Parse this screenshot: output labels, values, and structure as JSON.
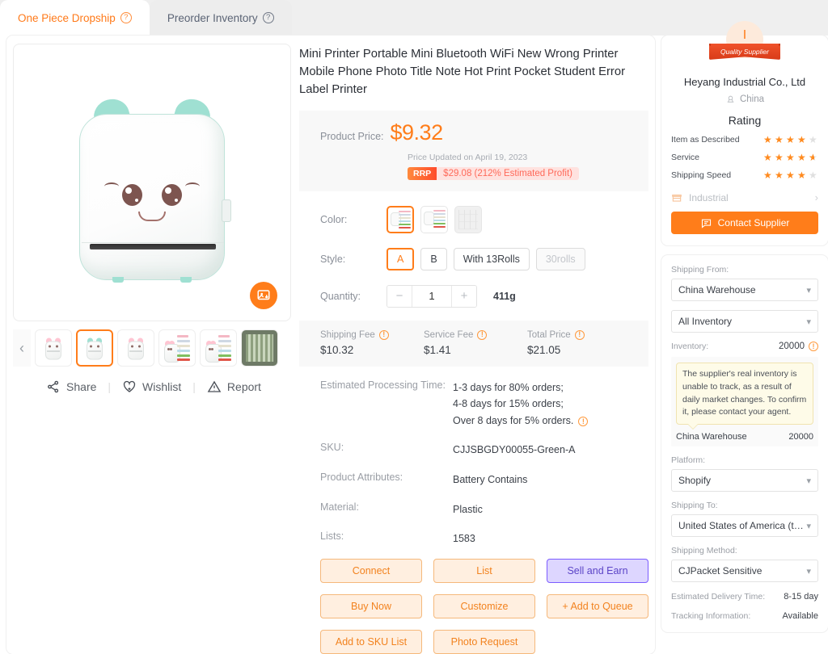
{
  "tabs": [
    {
      "label": "One Piece Dropship",
      "active": true
    },
    {
      "label": "Preorder Inventory",
      "active": false
    }
  ],
  "gallery": {
    "prev_icon": "chevron-left-icon",
    "download_icon": "image-download-icon",
    "selected_thumb_index": 1,
    "links": [
      {
        "label": "Share",
        "icon": "share-icon"
      },
      {
        "label": "Wishlist",
        "icon": "heart-plus-icon"
      },
      {
        "label": "Report",
        "icon": "warning-triangle-icon"
      }
    ],
    "separator": "|"
  },
  "product": {
    "title": "Mini Printer Portable Mini Bluetooth WiFi New Wrong Printer Mobile Phone Photo Title Note Hot Print Pocket Student Error Label Printer",
    "price_label": "Product Price:",
    "price": "$9.32",
    "price_updated": "Price Updated on April 19, 2023",
    "rrp_tag": "RRP",
    "rrp_text": "$29.08 (212% Estimated Profit)",
    "color_label": "Color:",
    "style_label": "Style:",
    "style_options": [
      {
        "label": "A",
        "state": "selected"
      },
      {
        "label": "B",
        "state": "normal"
      },
      {
        "label": "With 13Rolls",
        "state": "normal"
      },
      {
        "label": "30rolls",
        "state": "disabled"
      }
    ],
    "quantity_label": "Quantity:",
    "quantity_value": "1",
    "quantity_minus": "−",
    "quantity_plus": "+",
    "weight": "411g",
    "fees": [
      {
        "label": "Shipping Fee",
        "value": "$10.32"
      },
      {
        "label": "Service Fee",
        "value": "$1.41"
      },
      {
        "label": "Total Price",
        "value": "$21.05"
      }
    ],
    "specs": [
      {
        "key": "Estimated Processing Time:",
        "value": "1-3 days for 80% orders;\n4-8 days for 15% orders;\nOver 8 days for 5% orders.",
        "has_info": true
      },
      {
        "key": "SKU:",
        "value": "CJJSBGDY00055-Green-A",
        "has_info": false
      },
      {
        "key": "Product Attributes:",
        "value": "Battery Contains",
        "has_info": false
      },
      {
        "key": "Material:",
        "value": "Plastic",
        "has_info": false
      },
      {
        "key": "Lists:",
        "value": "1583",
        "has_info": false
      }
    ],
    "buttons": [
      [
        {
          "label": "Connect",
          "style": "ghost"
        },
        {
          "label": "List",
          "style": "ghost"
        },
        {
          "label": "Sell and Earn",
          "style": "purple"
        }
      ],
      [
        {
          "label": "Buy Now",
          "style": "ghost"
        },
        {
          "label": "Customize",
          "style": "ghost"
        },
        {
          "label": "+ Add to Queue",
          "style": "ghost"
        }
      ],
      [
        {
          "label": "Add to SKU List",
          "style": "ghost"
        },
        {
          "label": "Photo Request",
          "style": "ghost"
        },
        {
          "label": "",
          "style": "none"
        }
      ]
    ]
  },
  "supplier": {
    "badge_text": "Quality Supplier",
    "badge_mark": "I",
    "name": "Heyang Industrial Co., Ltd",
    "country": "China",
    "country_icon": "location-stamp-icon",
    "rating_title": "Rating",
    "ratings": [
      {
        "label": "Item as Described",
        "value": 4
      },
      {
        "label": "Service",
        "value": 4.5
      },
      {
        "label": "Shipping Speed",
        "value": 4
      }
    ],
    "category": "Industrial",
    "category_icon": "store-icon",
    "chevron": "›",
    "contact_label": "Contact Supplier",
    "contact_icon": "chat-bubble-icon"
  },
  "shipping": {
    "from_label": "Shipping From:",
    "from_value": "China Warehouse",
    "inventory_filter_value": "All Inventory",
    "inventory_label": "Inventory:",
    "inventory_value": "20000",
    "inventory_tooltip": "The supplier's real inventory is unable to track, as a result of daily market changes. To confirm it, please contact your agent.",
    "warehouse_name": "China Warehouse",
    "warehouse_qty": "20000",
    "platform_label": "Platform:",
    "platform_value": "Shopify",
    "to_label": "Shipping To:",
    "to_value": "United States of America (the)",
    "method_label": "Shipping Method:",
    "method_value": "CJPacket Sensitive",
    "delivery_label": "Estimated Delivery Time:",
    "delivery_value": "8-15 day",
    "tracking_label": "Tracking Information:",
    "tracking_value": "Available",
    "chevron_icon": "chevron-down-icon"
  },
  "colors": {
    "accent": "#ff7d1a",
    "purple": "#7c5cff",
    "star": "#ff8a1e",
    "rrp_bg": "#ffe2df"
  }
}
